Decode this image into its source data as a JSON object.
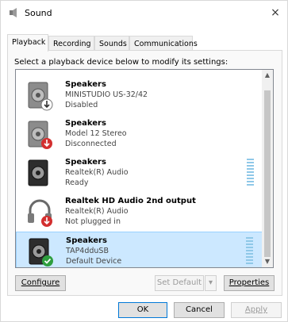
{
  "window": {
    "title": "Sound",
    "close_glyph": "×"
  },
  "tabs": [
    {
      "label": "Playback",
      "active": true
    },
    {
      "label": "Recording",
      "active": false
    },
    {
      "label": "Sounds",
      "active": false
    },
    {
      "label": "Communications",
      "active": false
    }
  ],
  "instruction": "Select a playback device below to modify its settings:",
  "devices": [
    {
      "name": "Speakers",
      "line2": "MINISTUDIO US-32/42",
      "line3": "Disabled",
      "icon": "speaker-icon",
      "badge": "down-arrow-badge-icon",
      "selected": false
    },
    {
      "name": "Speakers",
      "line2": "Model 12 Stereo",
      "line3": "Disconnected",
      "icon": "speaker-icon",
      "badge": "red-down-arrow-badge-icon",
      "selected": false
    },
    {
      "name": "Speakers",
      "line2": "Realtek(R) Audio",
      "line3": "Ready",
      "icon": "speaker-icon",
      "badge": "",
      "selected": false
    },
    {
      "name": "Realtek HD Audio 2nd output",
      "line2": "Realtek(R) Audio",
      "line3": "Not plugged in",
      "icon": "headphones-icon",
      "badge": "red-down-arrow-badge-icon",
      "selected": false
    },
    {
      "name": "Speakers",
      "line2": "TAP4dduSB",
      "line3": "Default Device",
      "icon": "speaker-icon",
      "badge": "green-check-badge-icon",
      "selected": true
    }
  ],
  "buttons": {
    "configure": "Configure",
    "set_default": "Set Default",
    "set_default_arrow": "▾",
    "properties": "Properties",
    "ok": "OK",
    "cancel": "Cancel",
    "apply": "Apply"
  },
  "scroll": {
    "up": "▲",
    "down": "▼"
  },
  "colors": {
    "selection": "#cce8ff",
    "selection_border": "#99d1ff",
    "accent": "#0078d7"
  }
}
